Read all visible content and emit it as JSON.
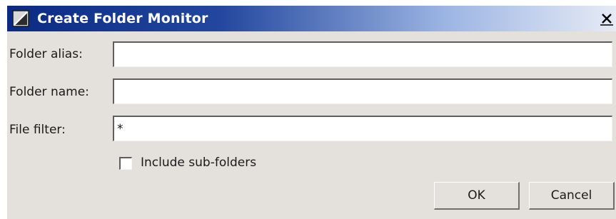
{
  "window": {
    "title": "Create Folder Monitor",
    "close_label": "x"
  },
  "form": {
    "folder_alias": {
      "label": "Folder alias:",
      "value": ""
    },
    "folder_name": {
      "label": "Folder name:",
      "value": ""
    },
    "file_filter": {
      "label": "File filter:",
      "value": "*"
    },
    "include_subfolders": {
      "label": "Include sub-folders",
      "checked": false
    }
  },
  "buttons": {
    "ok_label": "OK",
    "cancel_label": "Cancel"
  },
  "colors": {
    "title_gradient_start": "#0a2a83",
    "title_gradient_end": "#e6ebf5",
    "dialog_background": "#e4e1dc"
  },
  "icons": {
    "app": "window-app-icon",
    "close": "close-icon"
  }
}
